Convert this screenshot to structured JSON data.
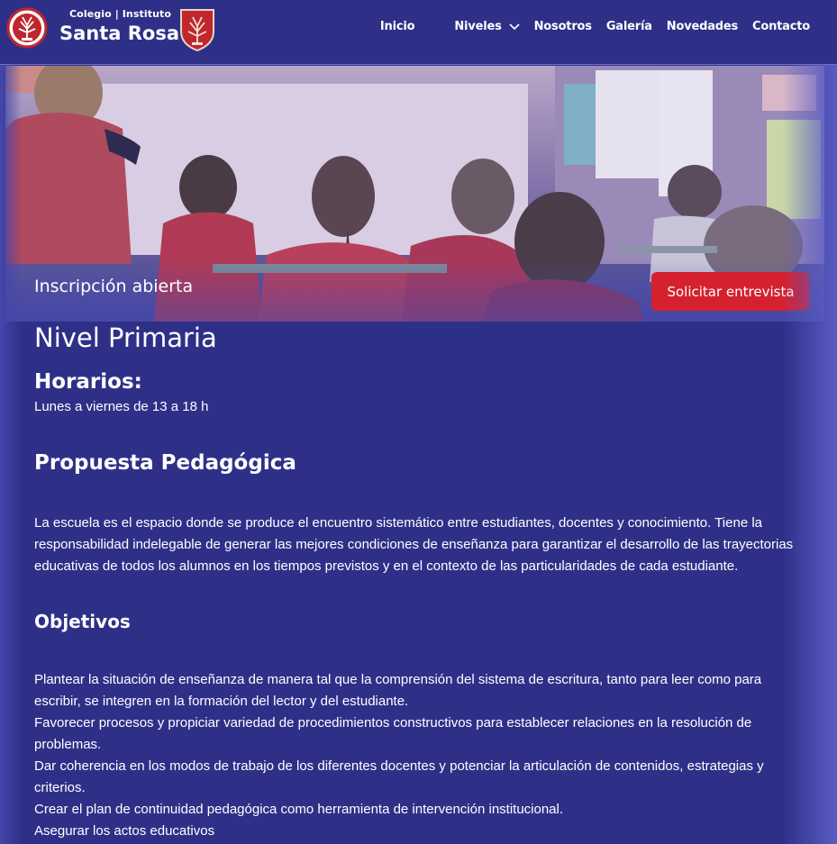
{
  "header": {
    "brand_top": "Colegio | Instituto",
    "brand_main": "Santa Rosa",
    "nav": [
      {
        "label": "Inicio"
      },
      {
        "label": "Niveles"
      },
      {
        "label": "Nosotros"
      },
      {
        "label": "Galería"
      },
      {
        "label": "Novedades"
      },
      {
        "label": "Contacto"
      }
    ]
  },
  "hero": {
    "caption": "Inscripción abierta",
    "cta_label": "Solicitar entrevista"
  },
  "main": {
    "level_title": "Nivel Primaria",
    "hours_title": "Horarios:",
    "hours_text": "Lunes a viernes de 13 a 18 h",
    "proposal_title": "Propuesta Pedagógica",
    "proposal_text": "La escuela es el espacio donde se produce el encuentro sistemático entre estudiantes, docentes y conocimiento. Tiene la responsabilidad indelegable de generar las mejores condiciones de enseñanza para garantizar el desarrollo de las trayectorias educativas de todos los alumnos en los tiempos previstos y en el contexto de las particularidades de cada estudiante.",
    "objectives_title": "Objetivos",
    "objectives": [
      "Plantear la situación de enseñanza de manera tal que la comprensión del sistema de escritura, tanto para leer como para escribir, se integren en la formación del lector y del estudiante.",
      "Favorecer procesos y propiciar variedad de procedimientos constructivos para establecer relaciones en la resolución de problemas.",
      "Dar coherencia en los modos de trabajo de los diferentes docentes y potenciar la articulación de contenidos, estrategias y criterios.",
      "Crear el plan de continuidad pedagógica como herramienta de intervención institucional.",
      "Asegurar los actos educativos"
    ]
  },
  "colors": {
    "background": "#2e3088",
    "cta": "#d5212e",
    "logo_red": "#c0262e"
  }
}
